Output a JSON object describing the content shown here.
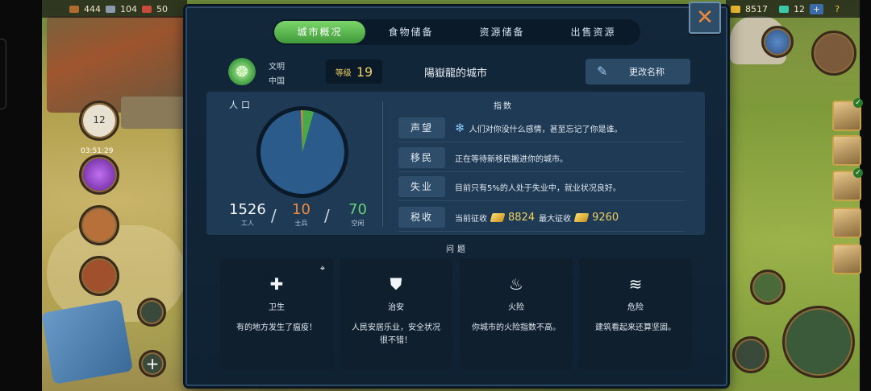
{
  "hud": {
    "resources_left": [
      "444",
      "104",
      "50"
    ],
    "gold_amount": "8517",
    "gems_amount": "12",
    "gems_plus": "+",
    "help": "?",
    "calendar_day": "12",
    "timer": "03:51:29"
  },
  "dialog": {
    "close_symbol": "✕",
    "tabs": [
      {
        "label": "城市概况",
        "active": true
      },
      {
        "label": "食物储备",
        "active": false
      },
      {
        "label": "资源储备",
        "active": false
      },
      {
        "label": "出售资源",
        "active": false
      }
    ],
    "civ_label": "文明",
    "civ_name": "中国",
    "level_label": "等级",
    "level_value": "19",
    "city_name": "陽嶽龍的城市",
    "rename_label": "更改名称",
    "population": {
      "label": "人口",
      "workers": "1526",
      "workers_label": "工人",
      "soldiers": "10",
      "soldiers_label": "士兵",
      "vacant": "70",
      "vacant_label": "空闲",
      "pie_colors": {
        "workers": "#2a5b8a",
        "soldiers": "#f08a3a",
        "vacant": "#4aa84a"
      }
    },
    "index": {
      "title": "指数",
      "rows": [
        {
          "tag": "声望",
          "text": "人们对你没什么感情，甚至忘记了你是谁。",
          "icon": "snowflake-icon"
        },
        {
          "tag": "移民",
          "text": "正在等待新移民搬进你的城市。"
        },
        {
          "tag": "失业",
          "text": "目前只有5%的人处于失业中，就业状况良好。"
        },
        {
          "tag": "税收",
          "current_label": "当前征收",
          "current_value": "8824",
          "max_label": "最大征收",
          "max_value": "9260"
        }
      ]
    },
    "problems": {
      "title": "问题",
      "cards": [
        {
          "icon": "cross-icon",
          "name": "卫生",
          "desc": "有的地方发生了瘟疫！",
          "pinned": true
        },
        {
          "icon": "shield-icon",
          "name": "治安",
          "desc": "人民安居乐业，安全状况很不错！"
        },
        {
          "icon": "fire-icon",
          "name": "火险",
          "desc": "你城市的火险指数不高。"
        },
        {
          "icon": "tornado-icon",
          "name": "危险",
          "desc": "建筑看起来还算坚固。"
        }
      ]
    }
  }
}
